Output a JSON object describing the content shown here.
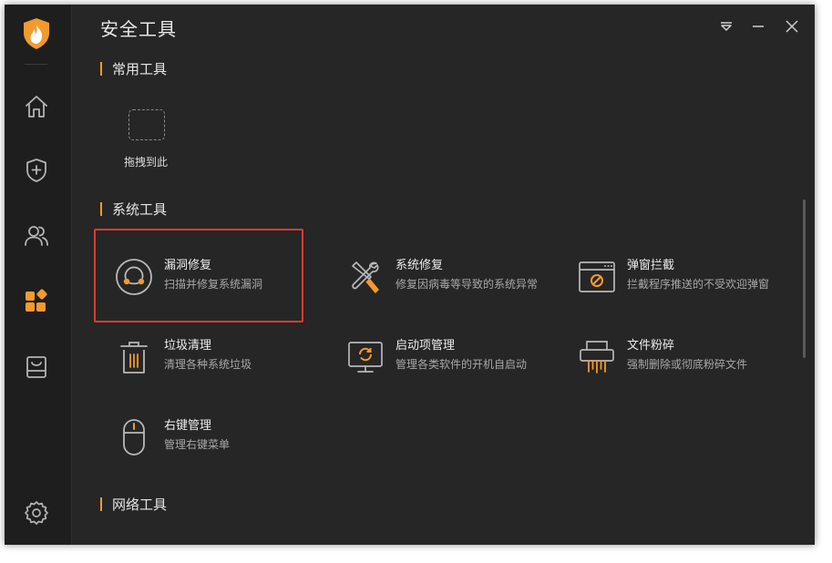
{
  "window": {
    "title": "安全工具"
  },
  "sidebar": {
    "logo_icon": "flame-shield-logo",
    "items": [
      {
        "name": "home",
        "icon": "home-icon"
      },
      {
        "name": "protection",
        "icon": "shield-plus-icon"
      },
      {
        "name": "account",
        "icon": "users-icon"
      },
      {
        "name": "tools",
        "icon": "apps-icon",
        "active": true
      },
      {
        "name": "box",
        "icon": "tray-icon"
      },
      {
        "name": "settings",
        "icon": "gear-icon"
      }
    ]
  },
  "sections": {
    "common": "常用工具",
    "system": "系统工具",
    "network": "网络工具"
  },
  "dropzone": {
    "label": "拖拽到此"
  },
  "tools": [
    {
      "name": "漏洞修复",
      "desc": "扫描并修复系统漏洞",
      "icon": "vuln-fix-icon",
      "highlighted": true
    },
    {
      "name": "系统修复",
      "desc": "修复因病毒等导致的系统异常",
      "icon": "wrench-screwdriver-icon"
    },
    {
      "name": "弹窗拦截",
      "desc": "拦截程序推送的不受欢迎弹窗",
      "icon": "popup-block-icon"
    },
    {
      "name": "垃圾清理",
      "desc": "清理各种系统垃圾",
      "icon": "trash-icon"
    },
    {
      "name": "启动项管理",
      "desc": "管理各类软件的开机自启动",
      "icon": "startup-monitor-icon"
    },
    {
      "name": "文件粉碎",
      "desc": "强制删除或彻底粉碎文件",
      "icon": "shredder-icon"
    },
    {
      "name": "右键管理",
      "desc": "管理右键菜单",
      "icon": "mouse-icon"
    }
  ],
  "colors": {
    "accent": "#f29a2e",
    "highlight_border": "#e03a2f",
    "background": "#262626",
    "sidebar": "#1e1e1e"
  }
}
